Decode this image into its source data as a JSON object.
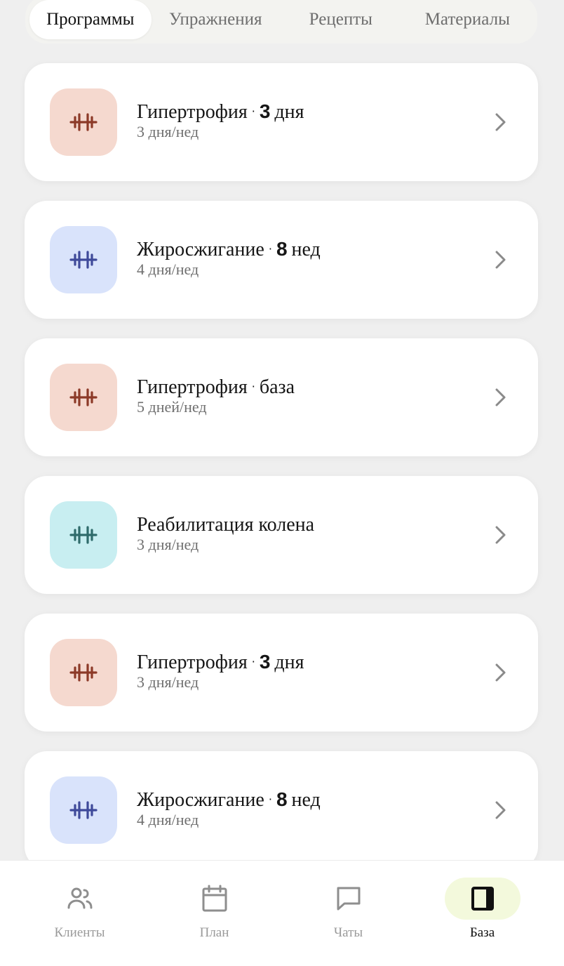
{
  "tabs": [
    {
      "label": "Программы",
      "active": true
    },
    {
      "label": "Упражнения",
      "active": false
    },
    {
      "label": "Рецепты",
      "active": false
    },
    {
      "label": "Материалы",
      "active": false
    }
  ],
  "programs": [
    {
      "name": "Гипертрофия",
      "dot": "·",
      "num": "3",
      "suffix": "дня",
      "subtitle": "3 дня/нед",
      "theme": "peach",
      "icon": "dumbbell-icon"
    },
    {
      "name": "Жиросжигание",
      "dot": "·",
      "num": "8",
      "suffix": "нед",
      "subtitle": "4 дня/нед",
      "theme": "blue",
      "icon": "dumbbell-icon"
    },
    {
      "name": "Гипертрофия",
      "dot": "·",
      "num": "",
      "suffix": "база",
      "subtitle": "5 дней/нед",
      "theme": "peach",
      "icon": "dumbbell-icon"
    },
    {
      "name": "Реабилитация колена",
      "dot": "",
      "num": "",
      "suffix": "",
      "subtitle": "3 дня/нед",
      "theme": "teal",
      "icon": "dumbbell-icon"
    },
    {
      "name": "Гипертрофия",
      "dot": "·",
      "num": "3",
      "suffix": "дня",
      "subtitle": "3 дня/нед",
      "theme": "peach",
      "icon": "dumbbell-icon"
    },
    {
      "name": "Жиросжигание",
      "dot": "·",
      "num": "8",
      "suffix": "нед",
      "subtitle": "4 дня/нед",
      "theme": "blue",
      "icon": "dumbbell-icon"
    }
  ],
  "themes": {
    "peach": {
      "bg": "#f5d9cf",
      "fg": "#8c3a28"
    },
    "blue": {
      "bg": "#d9e3fb",
      "fg": "#3f4a9a"
    },
    "teal": {
      "bg": "#c8eef1",
      "fg": "#2f6b6b"
    }
  },
  "nav": [
    {
      "label": "Клиенты",
      "icon": "clients-icon",
      "active": false
    },
    {
      "label": "План",
      "icon": "calendar-icon",
      "active": false
    },
    {
      "label": "Чаты",
      "icon": "chat-icon",
      "active": false
    },
    {
      "label": "База",
      "icon": "book-icon",
      "active": true
    }
  ],
  "colors": {
    "accent_nav_bg": "#f3f9dc",
    "inactive_text": "#9a9a9a"
  }
}
